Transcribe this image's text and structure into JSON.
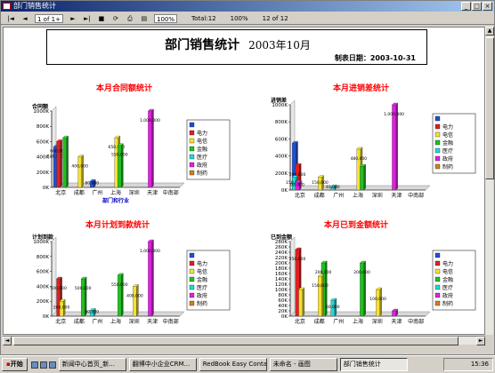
{
  "window": {
    "title": "部门销售统计"
  },
  "toolbar": {
    "page_indicator": "1 of 1+",
    "zoom": "100%",
    "total": "Total:12",
    "percent": "100%",
    "record": "12 of 12"
  },
  "report": {
    "title": "部门销售统计",
    "year_month": "2003年10月",
    "date_label": "制表日期：2003-10-31"
  },
  "legend_items": [
    "电力",
    "电信",
    "金融",
    "医疗",
    "政府",
    "制药"
  ],
  "colors": [
    "#1f4ed8",
    "#e02020",
    "#f5e030",
    "#20c020",
    "#20d8d8",
    "#e020e0",
    "#d08020"
  ],
  "chart_data": [
    {
      "type": "bar",
      "title": "本月合同额统计",
      "ylabel": "合同额",
      "xlabel": "部门和行业",
      "categories": [
        "北京",
        "成都",
        "广州",
        "上海",
        "深圳",
        "天津",
        "中南部"
      ],
      "yticks": [
        "0K",
        "200K",
        "400K",
        "600K",
        "800K",
        "1000K"
      ],
      "ylim": [
        0,
        1000
      ],
      "bars": [
        {
          "cat": 0,
          "series": 0,
          "value": 530,
          "label": "530,000"
        },
        {
          "cat": 0,
          "series": 1,
          "value": 600,
          "label": "600,000"
        },
        {
          "cat": 0,
          "series": 3,
          "value": 650,
          "label": ""
        },
        {
          "cat": 1,
          "series": 2,
          "value": 400,
          "label": "400,000"
        },
        {
          "cat": 2,
          "series": 0,
          "value": 80,
          "label": "80,000"
        },
        {
          "cat": 3,
          "series": 2,
          "value": 650,
          "label": "650,000"
        },
        {
          "cat": 3,
          "series": 3,
          "value": 550,
          "label": "550,000"
        },
        {
          "cat": 5,
          "series": 5,
          "value": 1000,
          "label": "1,000,000"
        }
      ]
    },
    {
      "type": "bar",
      "title": "本月进销差统计",
      "ylabel": "进销差",
      "xlabel": "",
      "categories": [
        "北京",
        "成都",
        "广州",
        "上海",
        "深圳",
        "天津",
        "中南部"
      ],
      "yticks": [
        "0K",
        "200K",
        "400K",
        "600K",
        "800K",
        "1000K"
      ],
      "ylim": [
        0,
        1000
      ],
      "bars": [
        {
          "cat": 0,
          "series": 0,
          "value": 550,
          "label": ""
        },
        {
          "cat": 0,
          "series": 1,
          "value": 290,
          "label": "290,000"
        },
        {
          "cat": 0,
          "series": 4,
          "value": 150,
          "label": "150,000"
        },
        {
          "cat": 0,
          "series": 5,
          "value": 90,
          "label": "90,000"
        },
        {
          "cat": 1,
          "series": 2,
          "value": 150,
          "label": "150,000"
        },
        {
          "cat": 2,
          "series": 4,
          "value": 40,
          "label": "40,000"
        },
        {
          "cat": 3,
          "series": 2,
          "value": 480,
          "label": "480,000"
        },
        {
          "cat": 3,
          "series": 3,
          "value": 280,
          "label": ""
        },
        {
          "cat": 5,
          "series": 5,
          "value": 1000,
          "label": "1,000,000"
        }
      ]
    },
    {
      "type": "bar",
      "title": "本月计划到款统计",
      "ylabel": "计划到款",
      "xlabel": "",
      "categories": [
        "北京",
        "成都",
        "广州",
        "上海",
        "深圳",
        "天津",
        "中南部"
      ],
      "yticks": [
        "0K",
        "200K",
        "400K",
        "600K",
        "800K",
        "1000K"
      ],
      "ylim": [
        0,
        1000
      ],
      "bars": [
        {
          "cat": 0,
          "series": 1,
          "value": 500,
          "label": "500,000"
        },
        {
          "cat": 0,
          "series": 2,
          "value": 200,
          "label": "200,000"
        },
        {
          "cat": 1,
          "series": 3,
          "value": 500,
          "label": "500,000"
        },
        {
          "cat": 2,
          "series": 4,
          "value": 80,
          "label": "80,000"
        },
        {
          "cat": 3,
          "series": 3,
          "value": 550,
          "label": "550,000"
        },
        {
          "cat": 4,
          "series": 2,
          "value": 400,
          "label": "400,000"
        },
        {
          "cat": 5,
          "series": 5,
          "value": 1000,
          "label": "1,000,000"
        }
      ]
    },
    {
      "type": "bar",
      "title": "本月已到金额统计",
      "ylabel": "已到金额",
      "xlabel": "",
      "categories": [
        "北京",
        "成都",
        "广州",
        "上海",
        "深圳",
        "天津",
        "中南部"
      ],
      "yticks": [
        "0K",
        "20K",
        "40K",
        "60K",
        "80K",
        "100K",
        "120K",
        "140K",
        "160K",
        "180K",
        "200K",
        "220K",
        "240K",
        "260K",
        "280K"
      ],
      "ylim": [
        0,
        280
      ],
      "bars": [
        {
          "cat": 0,
          "series": 1,
          "value": 250,
          "label": "250,000"
        },
        {
          "cat": 0,
          "series": 2,
          "value": 100,
          "label": ""
        },
        {
          "cat": 1,
          "series": 3,
          "value": 200,
          "label": "200,000"
        },
        {
          "cat": 1,
          "series": 2,
          "value": 150,
          "label": "150,000"
        },
        {
          "cat": 2,
          "series": 4,
          "value": 60,
          "label": "60,000"
        },
        {
          "cat": 3,
          "series": 3,
          "value": 200,
          "label": "200,000"
        },
        {
          "cat": 4,
          "series": 2,
          "value": 100,
          "label": "100,000"
        },
        {
          "cat": 5,
          "series": 5,
          "value": 20,
          "label": ""
        }
      ]
    }
  ],
  "taskbar": {
    "start": "开始",
    "tasks": [
      "新闻中心首页_新...",
      "翻博中小企业CRM...",
      "RedBook Easy Conta...",
      "未命名 - 画图",
      "部门销售统计"
    ],
    "clock": "15:36"
  }
}
